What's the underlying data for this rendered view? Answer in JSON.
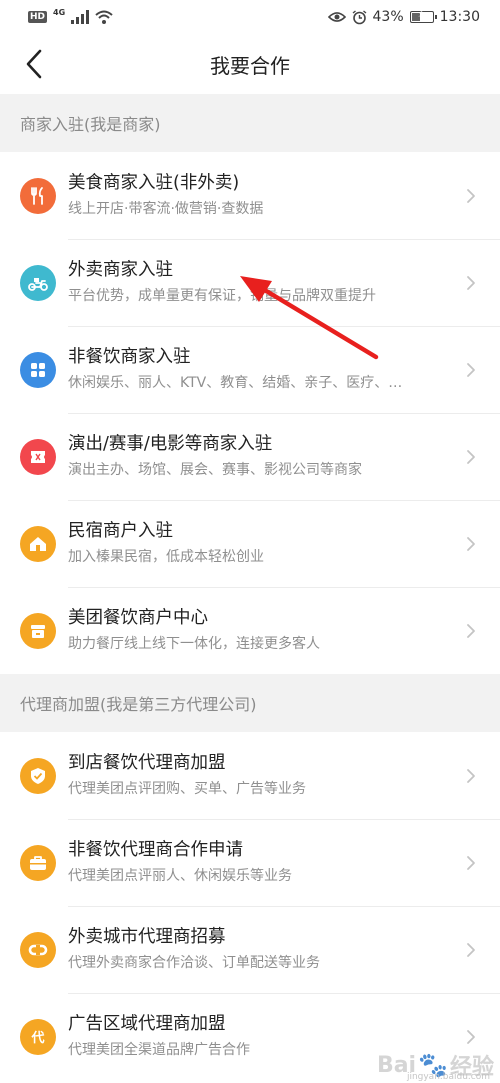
{
  "status_bar": {
    "hd_label": "HD",
    "network_label": "4G",
    "battery_percent": "43%",
    "battery_level": 0.43,
    "time": "13:30",
    "icons": [
      "signal-icon",
      "wifi-icon",
      "eye-icon",
      "alarm-icon",
      "battery-icon"
    ]
  },
  "navbar": {
    "title": "我要合作",
    "back_icon": "chevron-left-icon"
  },
  "sections": [
    {
      "header": "商家入驻(我是商家)",
      "items": [
        {
          "title": "美食商家入驻(非外卖)",
          "subtitle": "线上开店·带客流·做营销·查数据",
          "icon": "fork-knife-icon",
          "color": "#f26c3a"
        },
        {
          "title": "外卖商家入驻",
          "subtitle": "平台优势，成单量更有保证，销量与品牌双重提升",
          "icon": "scooter-icon",
          "color": "#3fb9cf"
        },
        {
          "title": "非餐饮商家入驻",
          "subtitle": "休闲娱乐、丽人、KTV、教育、结婚、亲子、医疗、…",
          "icon": "grid-icon",
          "color": "#3b8de3"
        },
        {
          "title": "演出/赛事/电影等商家入驻",
          "subtitle": "演出主办、场馆、展会、赛事、影视公司等商家",
          "icon": "ticket-icon",
          "color": "#f2474d"
        },
        {
          "title": "民宿商户入驻",
          "subtitle": "加入榛果民宿，低成本轻松创业",
          "icon": "house-icon",
          "color": "#f5a623"
        },
        {
          "title": "美团餐饮商户中心",
          "subtitle": "助力餐厅线上线下一体化，连接更多客人",
          "icon": "store-icon",
          "color": "#f5a623"
        }
      ]
    },
    {
      "header": "代理商加盟(我是第三方代理公司)",
      "items": [
        {
          "title": "到店餐饮代理商加盟",
          "subtitle": "代理美团点评团购、买单、广告等业务",
          "icon": "shield-check-icon",
          "color": "#f5a623"
        },
        {
          "title": "非餐饮代理商合作申请",
          "subtitle": "代理美团点评丽人、休闲娱乐等业务",
          "icon": "briefcase-icon",
          "color": "#f5a623"
        },
        {
          "title": "外卖城市代理商招募",
          "subtitle": "代理外卖商家合作洽谈、订单配送等业务",
          "icon": "link-icon",
          "color": "#f5a623"
        },
        {
          "title": "广告区域代理商加盟",
          "subtitle": "代理美团全渠道品牌广告合作",
          "icon": "dai-icon",
          "color": "#f5a623",
          "icon_text": "代"
        }
      ]
    }
  ],
  "watermark": {
    "text": "Bai",
    "text2": "经验",
    "sub": "jingyan.baidu.com"
  }
}
